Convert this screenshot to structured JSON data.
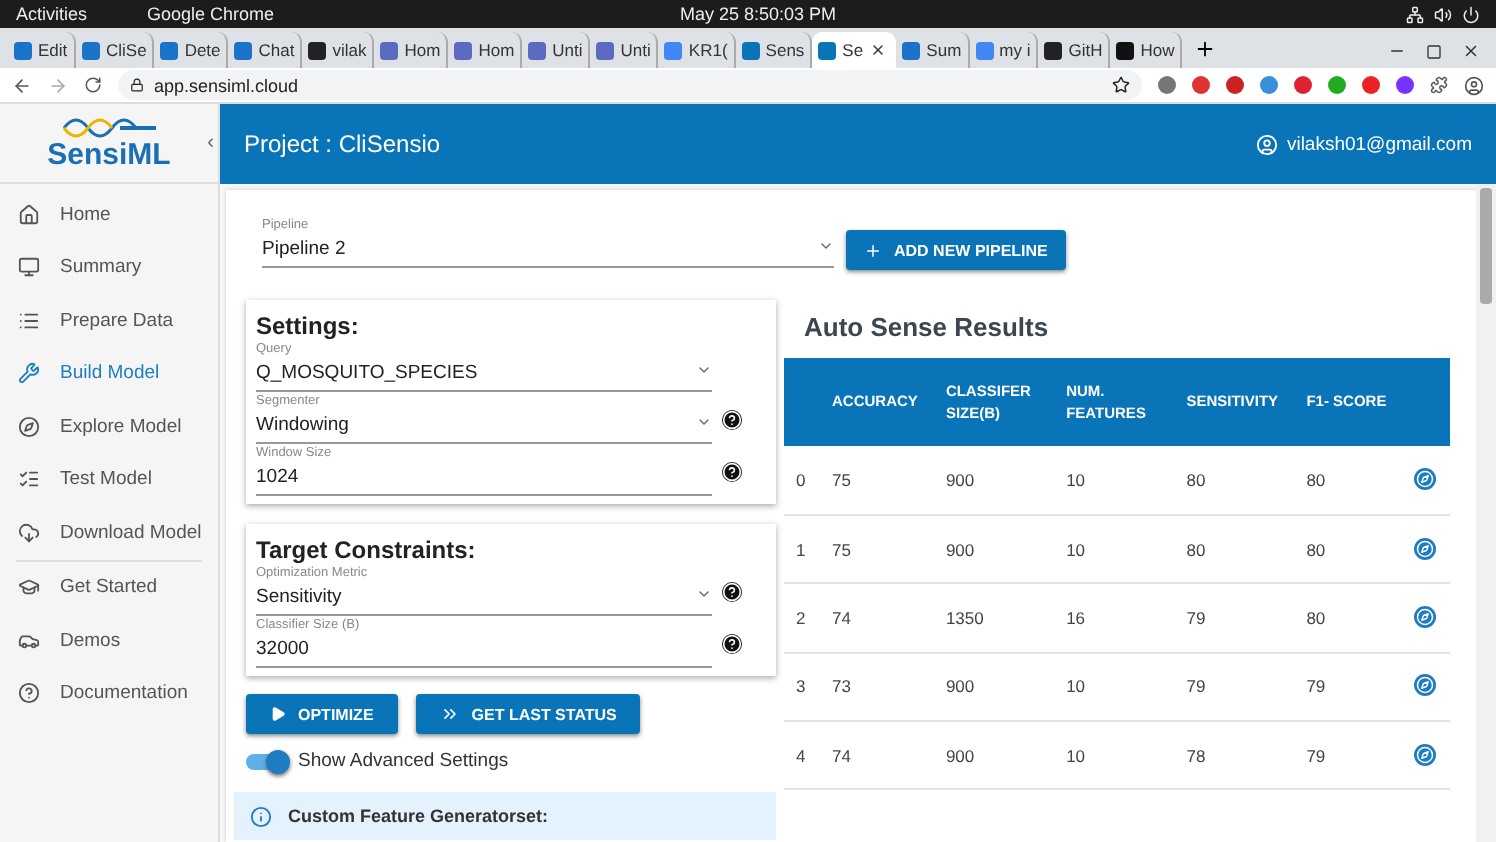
{
  "os_bar": {
    "activities": "Activities",
    "app": "Google Chrome",
    "clock": "May 25  8:50:03 PM"
  },
  "browser": {
    "tabs": [
      {
        "label": "Edit",
        "selected": false,
        "color": "#1a73c8"
      },
      {
        "label": "CliSe",
        "selected": false,
        "color": "#1a73c8"
      },
      {
        "label": "Dete",
        "selected": false,
        "color": "#1a73c8"
      },
      {
        "label": "Chat",
        "selected": false,
        "color": "#1a73c8"
      },
      {
        "label": "vilak",
        "selected": false,
        "color": "#222222"
      },
      {
        "label": "Hom",
        "selected": false,
        "color": "#5c6bc0"
      },
      {
        "label": "Hom",
        "selected": false,
        "color": "#5c6bc0"
      },
      {
        "label": "Unti",
        "selected": false,
        "color": "#5c6bc0"
      },
      {
        "label": "Unti",
        "selected": false,
        "color": "#5c6bc0"
      },
      {
        "label": "KR1(",
        "selected": false,
        "color": "#4285f4"
      },
      {
        "label": "Sens",
        "selected": false,
        "color": "#0a74b8"
      },
      {
        "label": "Se",
        "selected": true,
        "color": "#0a74b8"
      },
      {
        "label": "Sum",
        "selected": false,
        "color": "#1a73c8"
      },
      {
        "label": "my i",
        "selected": false,
        "color": "#4285f4"
      },
      {
        "label": "GitH",
        "selected": false,
        "color": "#222222"
      },
      {
        "label": "How",
        "selected": false,
        "color": "#111111"
      }
    ],
    "url": "app.sensiml.cloud"
  },
  "sidebar": {
    "logo": "SensiML",
    "collapse": "‹",
    "items": [
      {
        "label": "Home",
        "selected": false
      },
      {
        "label": "Summary",
        "selected": false
      },
      {
        "label": "Prepare Data",
        "selected": false
      },
      {
        "label": "Build Model",
        "selected": true
      },
      {
        "label": "Explore Model",
        "selected": false
      },
      {
        "label": "Test Model",
        "selected": false
      },
      {
        "label": "Download Model",
        "selected": false
      },
      {
        "label": "Get Started",
        "selected": false
      },
      {
        "label": "Demos",
        "selected": false
      },
      {
        "label": "Documentation",
        "selected": false
      }
    ]
  },
  "header": {
    "title": "Project : CliSensio",
    "user": "vilaksh01@gmail.com"
  },
  "pipeline": {
    "label": "Pipeline",
    "value": "Pipeline 2",
    "button": "ADD NEW PIPELINE"
  },
  "settings": {
    "title": "Settings:",
    "fields": [
      {
        "label": "Query",
        "value": "Q_MOSQUITO_SPECIES",
        "dropdown": true,
        "help": false
      },
      {
        "label": "Segmenter",
        "value": "Windowing",
        "dropdown": true,
        "help": true
      },
      {
        "label": "Window Size",
        "value": "1024",
        "dropdown": false,
        "help": true
      }
    ]
  },
  "constraints": {
    "title": "Target Constraints:",
    "fields": [
      {
        "label": "Optimization Metric",
        "value": "Sensitivity",
        "dropdown": true,
        "help": true
      },
      {
        "label": "Classifier Size (B)",
        "value": "32000",
        "dropdown": false,
        "help": true
      }
    ]
  },
  "actions": [
    "OPTIMIZE",
    "GET LAST STATUS"
  ],
  "advanced": {
    "label": "Show Advanced Settings",
    "on": true
  },
  "info": {
    "text": "Custom Feature Generatorset:"
  },
  "results": {
    "title": "Auto Sense Results",
    "columns": [
      "",
      "ACCURACY",
      "CLASSIFER SIZE(B)",
      "NUM. FEATURES",
      "SENSITIVITY",
      "F1- SCORE"
    ],
    "rows": [
      [
        "0",
        "75",
        "900",
        "10",
        "80",
        "80"
      ],
      [
        "1",
        "75",
        "900",
        "10",
        "80",
        "80"
      ],
      [
        "2",
        "74",
        "1350",
        "16",
        "79",
        "80"
      ],
      [
        "3",
        "73",
        "900",
        "10",
        "79",
        "79"
      ],
      [
        "4",
        "74",
        "900",
        "10",
        "78",
        "79"
      ]
    ]
  }
}
